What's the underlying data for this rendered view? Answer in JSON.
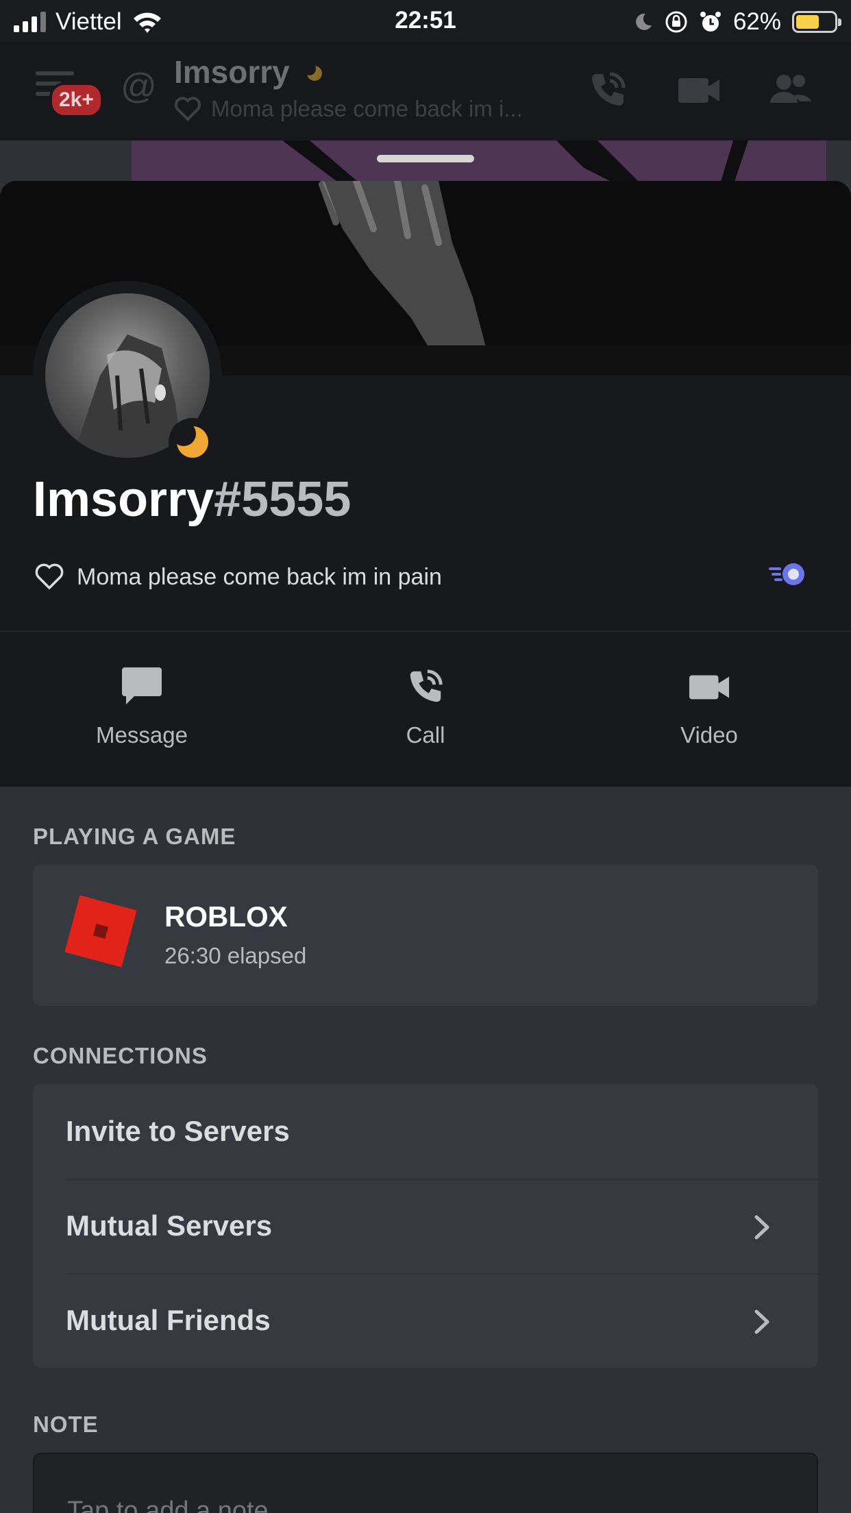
{
  "status_bar": {
    "carrier": "Viettel",
    "time": "22:51",
    "battery_percent": "62%",
    "battery_level": 0.62,
    "icons": [
      "signal-icon",
      "wifi-icon",
      "moon-icon",
      "rotation-lock-icon",
      "alarm-icon",
      "battery-icon"
    ]
  },
  "header": {
    "badge": "2k+",
    "at_symbol": "@",
    "name": "Imsorry",
    "status_preview": "Moma please come back im i...",
    "icons": [
      "menu-icon",
      "call-icon",
      "video-icon",
      "members-icon"
    ]
  },
  "profile": {
    "username": "Imsorry",
    "discriminator": "#5555",
    "custom_status": "Moma please come back im in pain",
    "presence": "idle",
    "colors": {
      "idle": "#f0a832",
      "nitro_accent": "#5865f2"
    }
  },
  "actions": {
    "message_label": "Message",
    "call_label": "Call",
    "video_label": "Video"
  },
  "activity": {
    "section_title": "PLAYING A GAME",
    "game_name": "ROBLOX",
    "elapsed": "26:30 elapsed",
    "game_color": "#e2231a"
  },
  "connections": {
    "section_title": "CONNECTIONS",
    "invite_label": "Invite to Servers",
    "mutual_servers_label": "Mutual Servers",
    "mutual_friends_label": "Mutual Friends"
  },
  "note": {
    "section_title": "NOTE",
    "placeholder": "Tap to add a note"
  }
}
